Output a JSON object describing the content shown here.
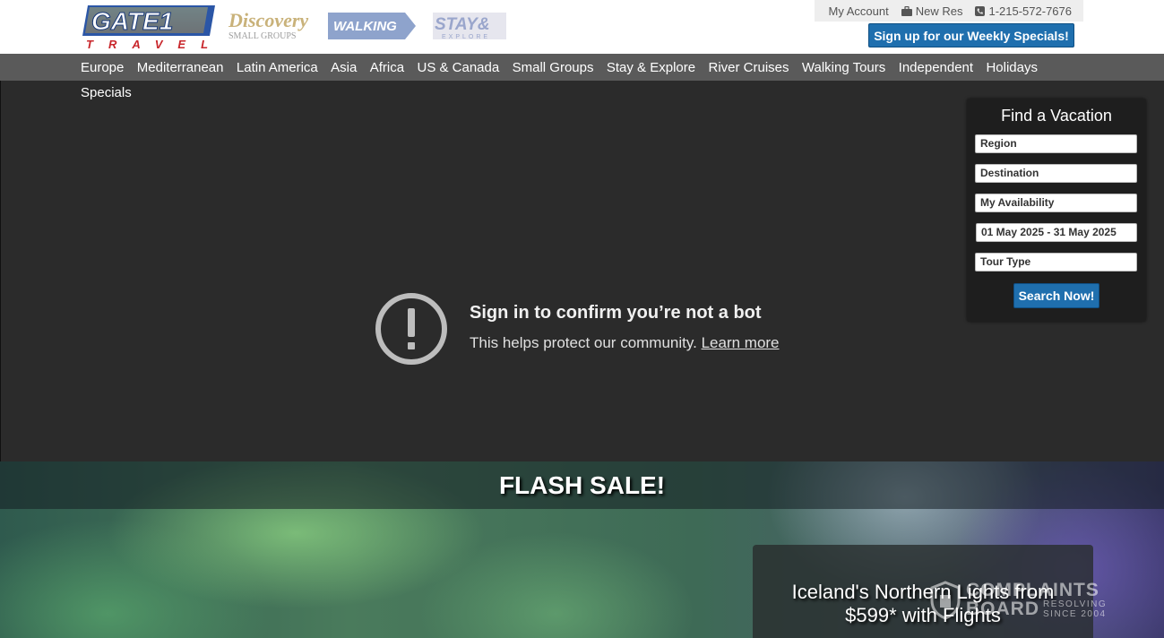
{
  "brand": {
    "logo_main_text": "GATE1",
    "logo_main_sub": "TRAVEL",
    "logo_discovery_text": "Discovery",
    "logo_discovery_sub": "SMALL GROUPS",
    "logo_walking_text": "WALKING",
    "logo_stay_text": "STAY&",
    "logo_stay_sub": "EXPLORE"
  },
  "util": {
    "account": "My Account",
    "new_res": "New Res",
    "phone": "1-215-572-7676"
  },
  "signup_label": "Sign up for our Weekly Specials!",
  "nav": {
    "items": [
      "Europe",
      "Mediterranean",
      "Latin America",
      "Asia",
      "Africa",
      "US & Canada",
      "Small Groups",
      "Stay & Explore",
      "River Cruises",
      "Walking Tours",
      "Independent",
      "Holidays"
    ],
    "overflow_item": "Specials"
  },
  "video_overlay": {
    "title": "Sign in to confirm you’re not a bot",
    "subtitle": "This helps protect our community.",
    "link": "Learn more"
  },
  "finder": {
    "title": "Find a Vacation",
    "region": "Region",
    "destination": "Destination",
    "availability": "My Availability",
    "date_range": "01 May 2025 - 31 May 2025",
    "tour_type": "Tour Type",
    "search_label": "Search Now!"
  },
  "hero": {
    "flash": "FLASH SALE!",
    "promo_line1": "Iceland's Northern Lights from",
    "promo_line2": "$599* with Flights"
  },
  "watermark": {
    "line1": "COMPLAINTS",
    "line2": "BOARD",
    "tag1": "RESOLVING",
    "tag2": "SINCE 2004"
  },
  "colors": {
    "accent_blue": "#1f6fae",
    "nav_gray": "#5a5a5a",
    "logo_blue": "#2b56a6",
    "logo_red": "#c8262b"
  }
}
